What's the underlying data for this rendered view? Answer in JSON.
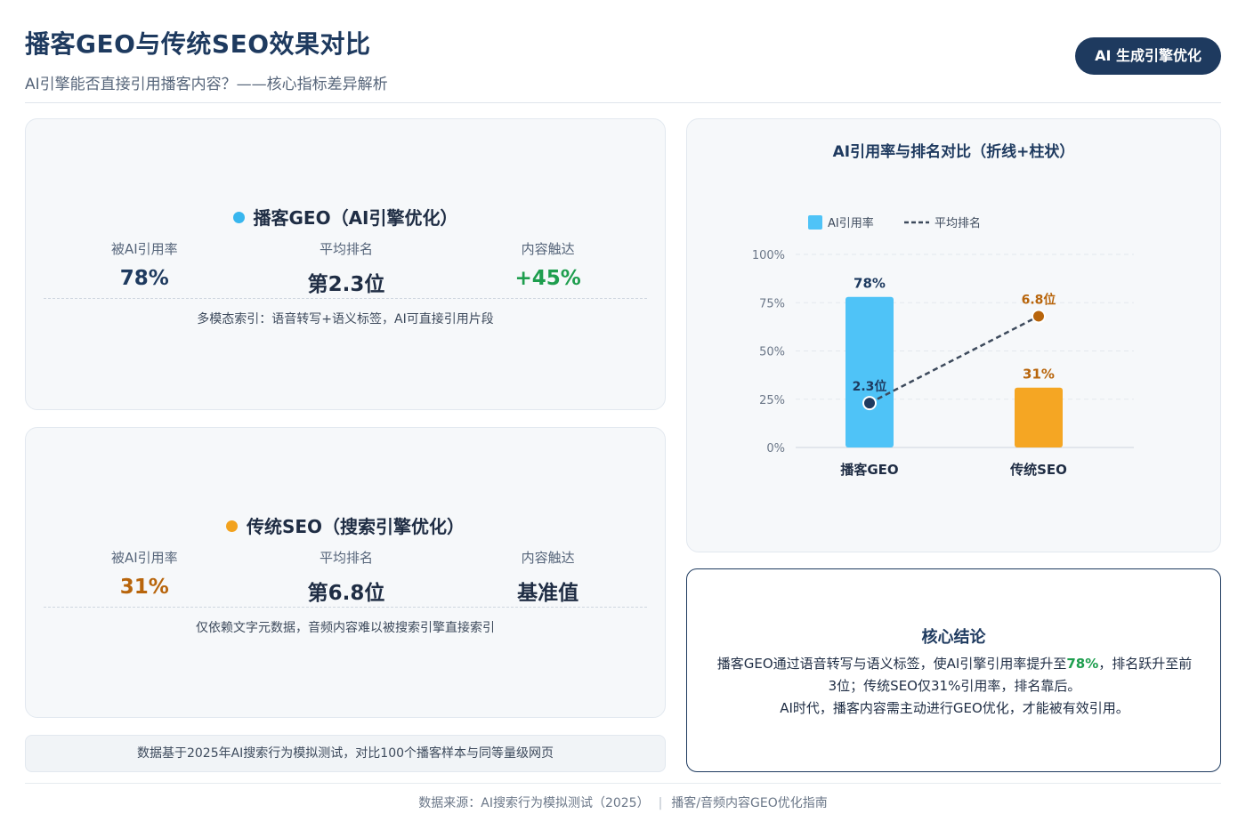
{
  "header": {
    "title": "播客GEO与传统SEO效果对比",
    "subtitle": "AI引擎能否直接引用播客内容？——核心指标差异解析",
    "badge": "AI 生成引擎优化"
  },
  "geo_card": {
    "title": "播客GEO（AI引擎优化）",
    "dot_color": "#38b6ee",
    "metrics": [
      {
        "label": "被AI引用率",
        "value": "78%",
        "color": "#1e3a5f"
      },
      {
        "label": "平均排名",
        "value": "第2.3位",
        "color": "#1f2d44"
      },
      {
        "label": "内容触达",
        "value": "+45%",
        "color": "#1e9e4e"
      }
    ],
    "note": "多模态索引：语音转写+语义标签，AI可直接引用片段"
  },
  "seo_card": {
    "title": "传统SEO（搜索引擎优化）",
    "dot_color": "#f2a21e",
    "metrics": [
      {
        "label": "被AI引用率",
        "value": "31%",
        "color": "#b8650c"
      },
      {
        "label": "平均排名",
        "value": "第6.8位",
        "color": "#1f2d44"
      },
      {
        "label": "内容触达",
        "value": "基准值",
        "color": "#1f2d44"
      }
    ],
    "note": "仅依赖文字元数据，音频内容难以被搜索引擎直接索引"
  },
  "footnote": "数据基于2025年AI搜索行为模拟测试，对比100个播客样本与同等量级网页",
  "chart_data": {
    "type": "bar",
    "title": "AI引用率与排名对比（折线+柱状）",
    "categories": [
      "播客GEO",
      "传统SEO"
    ],
    "series": [
      {
        "name": "AI引用率",
        "type": "bar",
        "values": [
          78,
          31
        ],
        "labels": [
          "78%",
          "31%"
        ],
        "colors": [
          "#4fc3f7",
          "#f5a623"
        ],
        "label_colors": [
          "#1e3a5f",
          "#b8650c"
        ]
      },
      {
        "name": "平均排名",
        "type": "line",
        "values": [
          2.3,
          6.8
        ],
        "labels": [
          "2.3位",
          "6.8位"
        ],
        "marker_colors": [
          "#1e3a5f",
          "#b8650c"
        ],
        "label_colors": [
          "#1e3a5f",
          "#b8650c"
        ]
      }
    ],
    "ylim": [
      0,
      100
    ],
    "yticks": [
      "0%",
      "25%",
      "50%",
      "75%",
      "100%"
    ],
    "ytick_values": [
      0,
      25,
      50,
      75,
      100
    ],
    "rank_scale_max": 10,
    "legend_position": "top-left",
    "grid": true
  },
  "conclusion": {
    "title": "核心结论",
    "line1_pre": "播客GEO通过语音转写与语义标签，使AI引擎引用率提升至",
    "line1_hl": "78%",
    "line1_post": "，排名跃升至前3位；传统SEO仅31%引用率，排名靠后。",
    "line2": "AI时代，播客内容需主动进行GEO优化，才能被有效引用。"
  },
  "footer": {
    "source": "数据来源：AI搜索行为模拟测试（2025）",
    "guide": "播客/音频内容GEO优化指南"
  }
}
